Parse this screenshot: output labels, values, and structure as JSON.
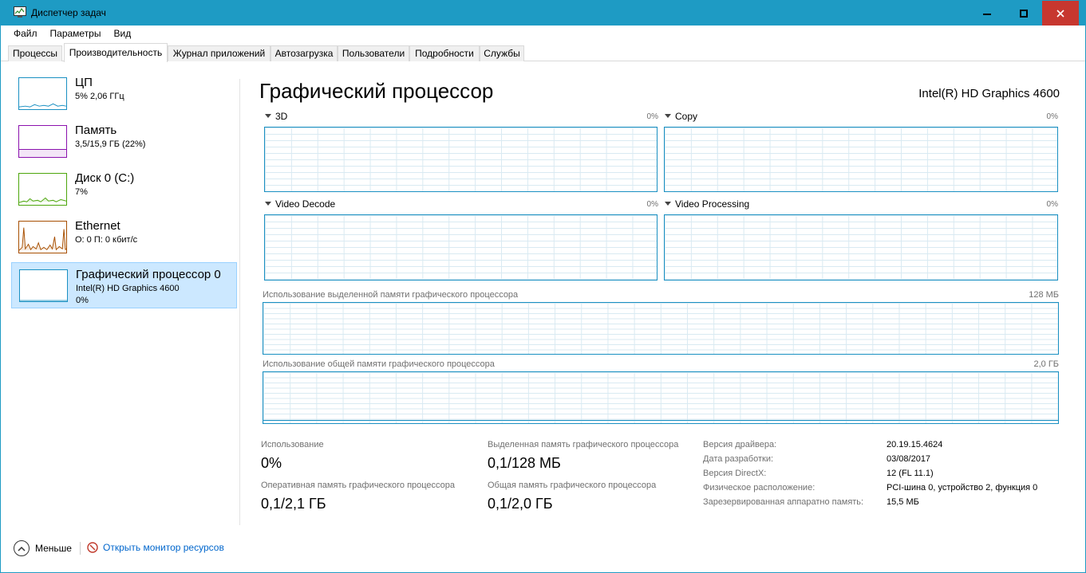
{
  "window": {
    "title": "Диспетчер задач"
  },
  "menu": {
    "items": [
      "Файл",
      "Параметры",
      "Вид"
    ]
  },
  "tabs": [
    {
      "label": "Процессы",
      "active": false
    },
    {
      "label": "Производительность",
      "active": true
    },
    {
      "label": "Журнал приложений",
      "active": false
    },
    {
      "label": "Автозагрузка",
      "active": false
    },
    {
      "label": "Пользователи",
      "active": false
    },
    {
      "label": "Подробности",
      "active": false
    },
    {
      "label": "Службы",
      "active": false
    }
  ],
  "sidebar": {
    "items": [
      {
        "name": "ЦП",
        "sub1": "5% 2,06 ГГц",
        "sub2": "",
        "color": "#1a90c2"
      },
      {
        "name": "Память",
        "sub1": "3,5/15,9 ГБ (22%)",
        "sub2": "",
        "color": "#8b12ae"
      },
      {
        "name": "Диск 0 (C:)",
        "sub1": "7%",
        "sub2": "",
        "color": "#4da60c"
      },
      {
        "name": "Ethernet",
        "sub1": "О: 0 П: 0 кбит/с",
        "sub2": "",
        "color": "#a74f01"
      },
      {
        "name": "Графический процессор 0",
        "sub1": "Intel(R) HD Graphics 4600",
        "sub2": "0%",
        "color": "#1a90c2",
        "selected": true
      }
    ]
  },
  "main": {
    "title": "Графический процессор",
    "model": "Intel(R) HD Graphics 4600",
    "engines": [
      {
        "label": "3D",
        "percent": "0%"
      },
      {
        "label": "Copy",
        "percent": "0%"
      },
      {
        "label": "Video Decode",
        "percent": "0%"
      },
      {
        "label": "Video Processing",
        "percent": "0%"
      }
    ],
    "dedicated_memory": {
      "label": "Использование выделенной памяти графического процессора",
      "max": "128 МБ"
    },
    "shared_memory": {
      "label": "Использование общей памяти графического процессора",
      "max": "2,0 ГБ"
    },
    "stats": [
      {
        "label": "Использование",
        "value": "0%"
      },
      {
        "label": "Выделенная память графического процессора",
        "value": "0,1/128 МБ"
      },
      {
        "label": "Оперативная память графического процессора",
        "value": "0,1/2,1 ГБ"
      },
      {
        "label": "Общая память графического процессора",
        "value": "0,1/2,0 ГБ"
      }
    ],
    "info": [
      {
        "label": "Версия драйвера:",
        "value": "20.19.15.4624"
      },
      {
        "label": "Дата разработки:",
        "value": "03/08/2017"
      },
      {
        "label": "Версия DirectX:",
        "value": "12 (FL 11.1)"
      },
      {
        "label": "Физическое расположение:",
        "value": "PCI-шина 0, устройство 2, функция 0"
      },
      {
        "label": "Зарезервированная аппаратно память:",
        "value": "15,5 МБ"
      }
    ]
  },
  "footer": {
    "less_label": "Меньше",
    "monitor_link": "Открыть монитор ресурсов"
  }
}
